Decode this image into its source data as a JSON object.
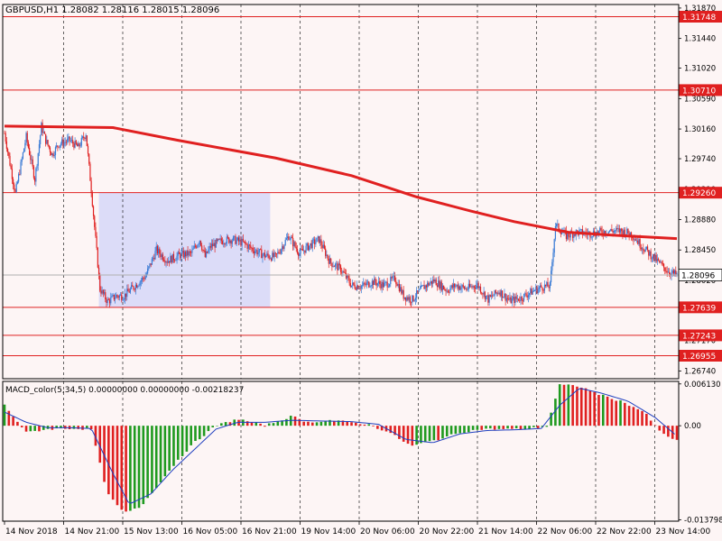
{
  "colors": {
    "background": "#fdf5f5",
    "bull": "#3a7bd5",
    "bear": "#e02020",
    "ma": "#e02020",
    "level_line": "#e02020",
    "level_label_bg": "#e02020",
    "current_label_bg": "#ffffff",
    "zone_fill": "#dcdcf8",
    "hist_up": "#1f9a1f",
    "hist_down": "#e02020",
    "signal": "#1f3fbf"
  },
  "chart_data": {
    "type": "candlestick",
    "title": "GBPUSD,H1  1.28082 1.28116 1.28015 1.28096",
    "price_axis": {
      "ticks": [
        "1.31870",
        "1.31440",
        "1.31020",
        "1.30590",
        "1.30160",
        "1.29740",
        "1.29310",
        "1.28880",
        "1.28450",
        "1.28020",
        "1.27170",
        "1.26740"
      ],
      "min": 1.2663,
      "max": 1.3192
    },
    "time_axis": {
      "labels": [
        "14 Nov 2018",
        "14 Nov 21:00",
        "15 Nov 13:00",
        "16 Nov 05:00",
        "16 Nov 21:00",
        "19 Nov 14:00",
        "20 Nov 06:00",
        "20 Nov 22:00",
        "21 Nov 14:00",
        "22 Nov 06:00",
        "22 Nov 22:00",
        "23 Nov 14:00"
      ]
    },
    "levels": [
      "1.31748",
      "1.30710",
      "1.29260",
      "1.27639",
      "1.27243",
      "1.26955"
    ],
    "current_price": "1.28096",
    "zone": {
      "from_bar": 87,
      "to_bar": 245,
      "high": 1.2926,
      "low": 1.2764
    },
    "anchors": [
      [
        0,
        1.301
      ],
      [
        10,
        1.2925
      ],
      [
        20,
        1.3005
      ],
      [
        28,
        1.2945
      ],
      [
        34,
        1.302
      ],
      [
        38,
        1.3
      ],
      [
        44,
        1.298
      ],
      [
        50,
        1.2995
      ],
      [
        60,
        1.3
      ],
      [
        68,
        1.299
      ],
      [
        75,
        1.301
      ],
      [
        80,
        1.293
      ],
      [
        88,
        1.279
      ],
      [
        95,
        1.2772
      ],
      [
        103,
        1.278
      ],
      [
        110,
        1.278
      ],
      [
        120,
        1.2794
      ],
      [
        130,
        1.2808
      ],
      [
        140,
        1.2845
      ],
      [
        150,
        1.283
      ],
      [
        162,
        1.2838
      ],
      [
        172,
        1.284
      ],
      [
        180,
        1.286
      ],
      [
        185,
        1.2835
      ],
      [
        190,
        1.285
      ],
      [
        200,
        1.2858
      ],
      [
        210,
        1.286
      ],
      [
        220,
        1.2855
      ],
      [
        230,
        1.2845
      ],
      [
        240,
        1.2837
      ],
      [
        250,
        1.2835
      ],
      [
        262,
        1.2865
      ],
      [
        272,
        1.284
      ],
      [
        280,
        1.285
      ],
      [
        290,
        1.286
      ],
      [
        300,
        1.2828
      ],
      [
        310,
        1.2818
      ],
      [
        320,
        1.2795
      ],
      [
        330,
        1.2794
      ],
      [
        340,
        1.28
      ],
      [
        350,
        1.2795
      ],
      [
        360,
        1.2805
      ],
      [
        368,
        1.278
      ],
      [
        376,
        1.2775
      ],
      [
        386,
        1.2792
      ],
      [
        396,
        1.2802
      ],
      [
        408,
        1.2788
      ],
      [
        416,
        1.2795
      ],
      [
        426,
        1.279
      ],
      [
        436,
        1.2796
      ],
      [
        446,
        1.2775
      ],
      [
        456,
        1.2787
      ],
      [
        466,
        1.2773
      ],
      [
        476,
        1.2777
      ],
      [
        486,
        1.2786
      ],
      [
        496,
        1.2793
      ],
      [
        503,
        1.2794
      ],
      [
        508,
        1.288
      ],
      [
        518,
        1.2865
      ],
      [
        528,
        1.287
      ],
      [
        538,
        1.2868
      ],
      [
        548,
        1.287
      ],
      [
        558,
        1.2872
      ],
      [
        568,
        1.2872
      ],
      [
        578,
        1.2868
      ],
      [
        588,
        1.285
      ],
      [
        598,
        1.2835
      ],
      [
        608,
        1.282
      ],
      [
        615,
        1.2812
      ],
      [
        620,
        1.281
      ]
    ],
    "bar_count": 621,
    "moving_average": {
      "line": [
        [
          0,
          1.302
        ],
        [
          100,
          1.3018
        ],
        [
          160,
          1.3
        ],
        [
          250,
          1.2975
        ],
        [
          320,
          1.295
        ],
        [
          380,
          1.292
        ],
        [
          430,
          1.29
        ],
        [
          470,
          1.2885
        ],
        [
          520,
          1.287
        ],
        [
          560,
          1.2866
        ],
        [
          620,
          1.2861
        ]
      ]
    },
    "macd": {
      "label": "MACD_color(5,34,5) 0.00000000 0.00000000 -0.00218237",
      "ticks": [
        "0.006130",
        "0.00",
        "-0.013798"
      ],
      "min": -0.014,
      "max": 0.0065,
      "hist_anchors": [
        [
          0,
          0.003
        ],
        [
          20,
          -0.001
        ],
        [
          40,
          -0.0005
        ],
        [
          60,
          -0.0004
        ],
        [
          80,
          -0.0005
        ],
        [
          95,
          -0.01
        ],
        [
          110,
          -0.0128
        ],
        [
          125,
          -0.012
        ],
        [
          145,
          -0.008
        ],
        [
          160,
          -0.005
        ],
        [
          175,
          -0.0025
        ],
        [
          195,
          0.0
        ],
        [
          215,
          0.001
        ],
        [
          240,
          0.0
        ],
        [
          265,
          0.0014
        ],
        [
          280,
          0.0005
        ],
        [
          300,
          0.0008
        ],
        [
          320,
          0.0005
        ],
        [
          335,
          0.0002
        ],
        [
          355,
          -0.001
        ],
        [
          375,
          -0.003
        ],
        [
          400,
          -0.002
        ],
        [
          420,
          -0.001
        ],
        [
          440,
          -0.0005
        ],
        [
          460,
          -0.0005
        ],
        [
          480,
          -0.0005
        ],
        [
          500,
          -0.0001
        ],
        [
          512,
          0.006
        ],
        [
          530,
          0.0058
        ],
        [
          550,
          0.0045
        ],
        [
          570,
          0.0035
        ],
        [
          590,
          0.002
        ],
        [
          605,
          -0.001
        ],
        [
          620,
          -0.0022
        ]
      ],
      "signal_anchors": [
        [
          0,
          0.002
        ],
        [
          20,
          0.0005
        ],
        [
          40,
          -0.0003
        ],
        [
          60,
          -0.0003
        ],
        [
          80,
          -0.0004
        ],
        [
          100,
          -0.007
        ],
        [
          115,
          -0.0115
        ],
        [
          135,
          -0.01
        ],
        [
          155,
          -0.0065
        ],
        [
          175,
          -0.0035
        ],
        [
          195,
          -0.0005
        ],
        [
          215,
          0.0005
        ],
        [
          240,
          0.0005
        ],
        [
          265,
          0.0008
        ],
        [
          290,
          0.0007
        ],
        [
          320,
          0.0006
        ],
        [
          345,
          0.0002
        ],
        [
          370,
          -0.002
        ],
        [
          395,
          -0.0025
        ],
        [
          420,
          -0.0012
        ],
        [
          445,
          -0.0007
        ],
        [
          470,
          -0.0006
        ],
        [
          495,
          -0.0004
        ],
        [
          512,
          0.003
        ],
        [
          530,
          0.0055
        ],
        [
          550,
          0.0048
        ],
        [
          575,
          0.0036
        ],
        [
          600,
          0.0012
        ],
        [
          620,
          -0.0015
        ]
      ]
    }
  }
}
